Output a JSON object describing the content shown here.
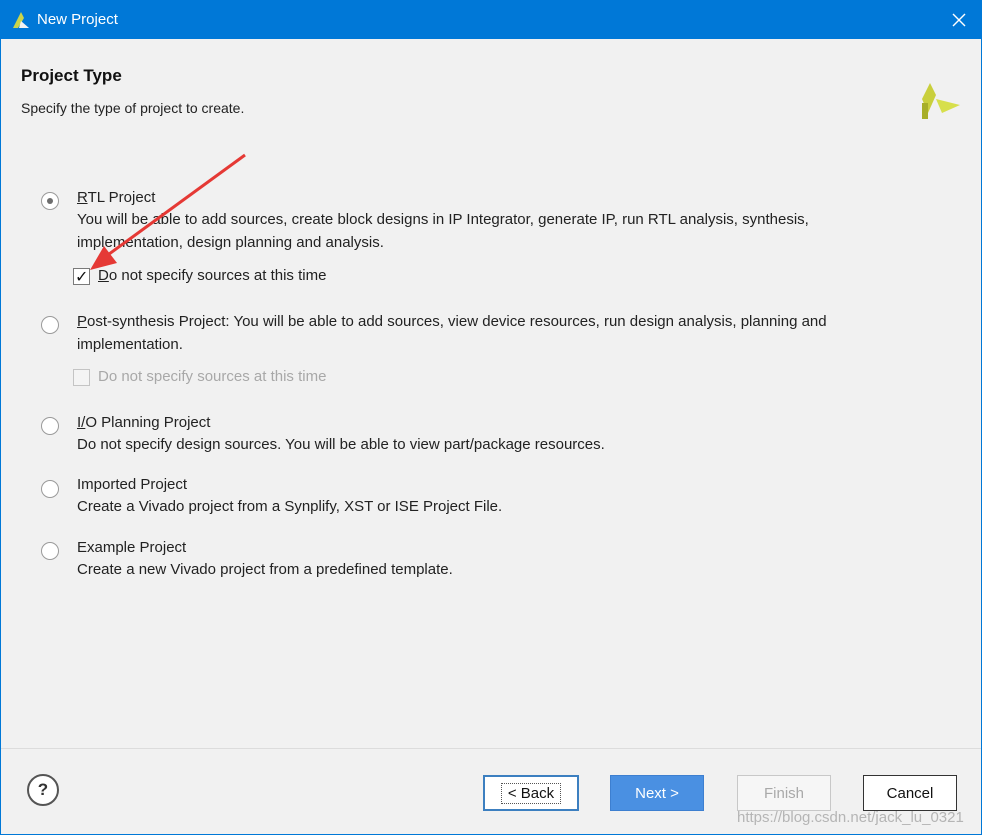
{
  "window": {
    "title": "New Project",
    "icon": "vivado-app-icon",
    "close_icon": "close-icon"
  },
  "header": {
    "title": "Project Type",
    "subtitle": "Specify the type of project to create.",
    "logo": "xilinx-logo"
  },
  "options": [
    {
      "id": "rtl",
      "label": "RTL Project",
      "description": "You will be able to add sources, create block designs in IP Integrator, generate IP, run RTL analysis, synthesis, implementation, design planning and analysis.",
      "selected": true,
      "checkbox_label": "Do not specify sources at this time",
      "checkbox_checked": true,
      "checkbox_enabled": true
    },
    {
      "id": "post-synthesis",
      "label": "Post-synthesis Project: You will be able to add sources, view device resources, run design analysis, planning and implementation.",
      "selected": false,
      "checkbox_label": "Do not specify sources at this time",
      "checkbox_checked": false,
      "checkbox_enabled": false
    },
    {
      "id": "io-planning",
      "label": "I/O Planning Project",
      "description": "Do not specify design sources. You will be able to view part/package resources.",
      "selected": false
    },
    {
      "id": "imported",
      "label": "Imported Project",
      "description": "Create a Vivado project from a Synplify, XST or ISE Project File.",
      "selected": false
    },
    {
      "id": "example",
      "label": "Example Project",
      "description": "Create a new Vivado project from a predefined template.",
      "selected": false
    }
  ],
  "footer": {
    "help_label": "?",
    "back_label": "< Back",
    "next_label": "Next >",
    "finish_label": "Finish",
    "cancel_label": "Cancel"
  },
  "watermark": "https://blog.csdn.net/jack_lu_0321",
  "colors": {
    "titlebar": "#0078d7",
    "next_button": "#4a90e2",
    "annotation_arrow": "#e53935"
  }
}
